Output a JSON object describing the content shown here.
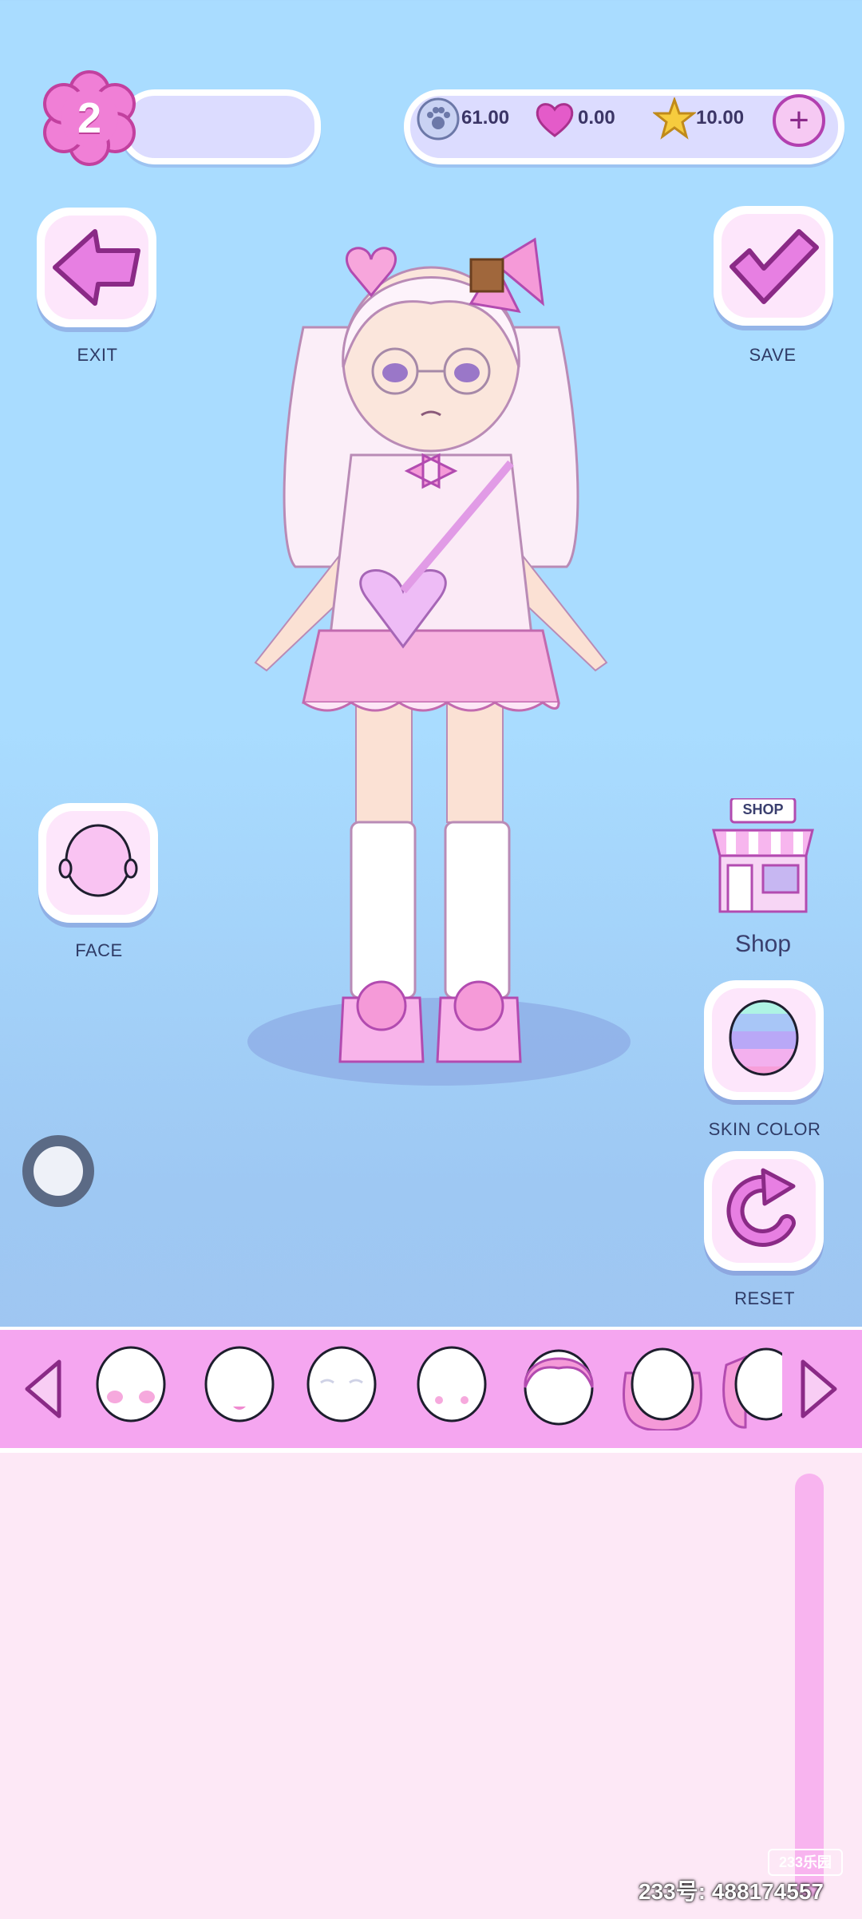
{
  "level": {
    "value": "2"
  },
  "currency": {
    "paw": "61.00",
    "heart": "0.00",
    "star": "10.00",
    "add_label": "+"
  },
  "buttons": {
    "exit": "EXIT",
    "save": "SAVE",
    "face": "FACE",
    "shop": "Shop",
    "shop_sign": "SHOP",
    "skin_color": "SKIN COLOR",
    "reset": "RESET"
  },
  "category_strip": {
    "items": [
      "face-blush",
      "face-mouth",
      "face-eyes",
      "face-base",
      "hair-short",
      "hair-long",
      "hair-ponytail"
    ]
  },
  "watermark": {
    "id_text": "233号: 488174557",
    "badge": "233乐园"
  },
  "colors": {
    "background": "#a9dcff",
    "accent_pink": "#f5a6f0",
    "button_icon": "#e585e6",
    "panel": "#fde8f6"
  }
}
